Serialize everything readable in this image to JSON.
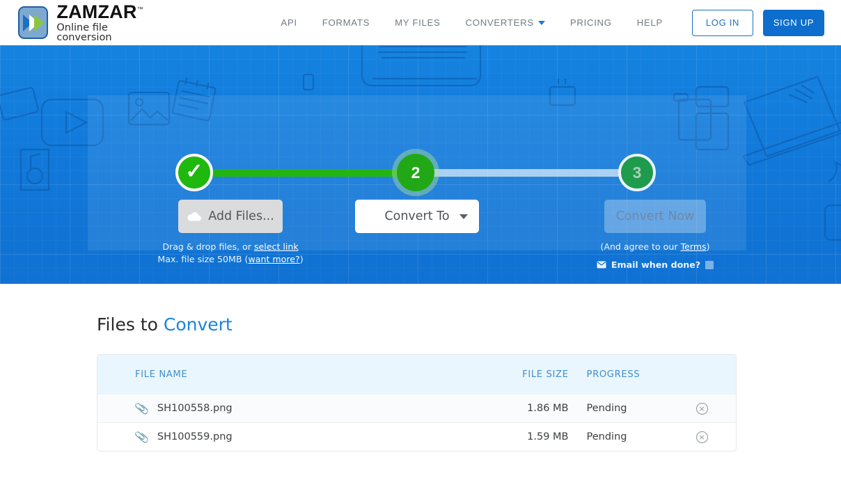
{
  "header": {
    "logo": {
      "icon": "zamzar-chevron-logo",
      "word": "ZAMZAR",
      "tm": "™",
      "tagline": "Online file conversion"
    },
    "nav": [
      {
        "label": "API",
        "has_caret": false
      },
      {
        "label": "FORMATS",
        "has_caret": false
      },
      {
        "label": "MY FILES",
        "has_caret": false
      },
      {
        "label": "CONVERTERS",
        "has_caret": true
      },
      {
        "label": "PRICING",
        "has_caret": false
      },
      {
        "label": "HELP",
        "has_caret": false
      }
    ],
    "login_label": "LOG IN",
    "signup_label": "SIGN UP"
  },
  "hero": {
    "steps": [
      {
        "id": 1,
        "glyph": "✓",
        "state": "complete"
      },
      {
        "id": 2,
        "glyph": "2",
        "state": "active"
      },
      {
        "id": 3,
        "glyph": "3",
        "state": "upcoming"
      }
    ],
    "step1": {
      "button_label": "Add Files...",
      "button_icon": "cloud-upload-icon",
      "note_line1_pre": "Drag & drop files, or ",
      "note_line1_link": "select link",
      "note_line2_pre": "Max. file size 50MB (",
      "note_line2_link": "want more?",
      "note_line2_post": ")"
    },
    "step2": {
      "select_value": "Convert To",
      "select_caret": "chevron-down-icon"
    },
    "step3": {
      "button_label": "Convert Now",
      "terms_pre": "(And agree to our ",
      "terms_link": "Terms",
      "terms_post": ")",
      "email_icon": "envelope-icon",
      "email_label": "Email when done?",
      "email_checked": false
    }
  },
  "files": {
    "title_plain": "Files to ",
    "title_accent": "Convert",
    "columns": {
      "name": "FILE NAME",
      "size": "FILE SIZE",
      "progress": "PROGRESS"
    },
    "rows": [
      {
        "icon": "paperclip-icon",
        "name": "SH100558.png",
        "size": "1.86 MB",
        "progress": "Pending",
        "remove": "×"
      },
      {
        "icon": "paperclip-icon",
        "name": "SH100559.png",
        "size": "1.59 MB",
        "progress": "Pending",
        "remove": "×"
      }
    ]
  },
  "colors": {
    "brand_blue": "#0d6ecd",
    "hero_blue": "#1179da",
    "step_green": "#22b512",
    "accent_link": "#1a84d8",
    "header_text": "#3f8fcf"
  }
}
